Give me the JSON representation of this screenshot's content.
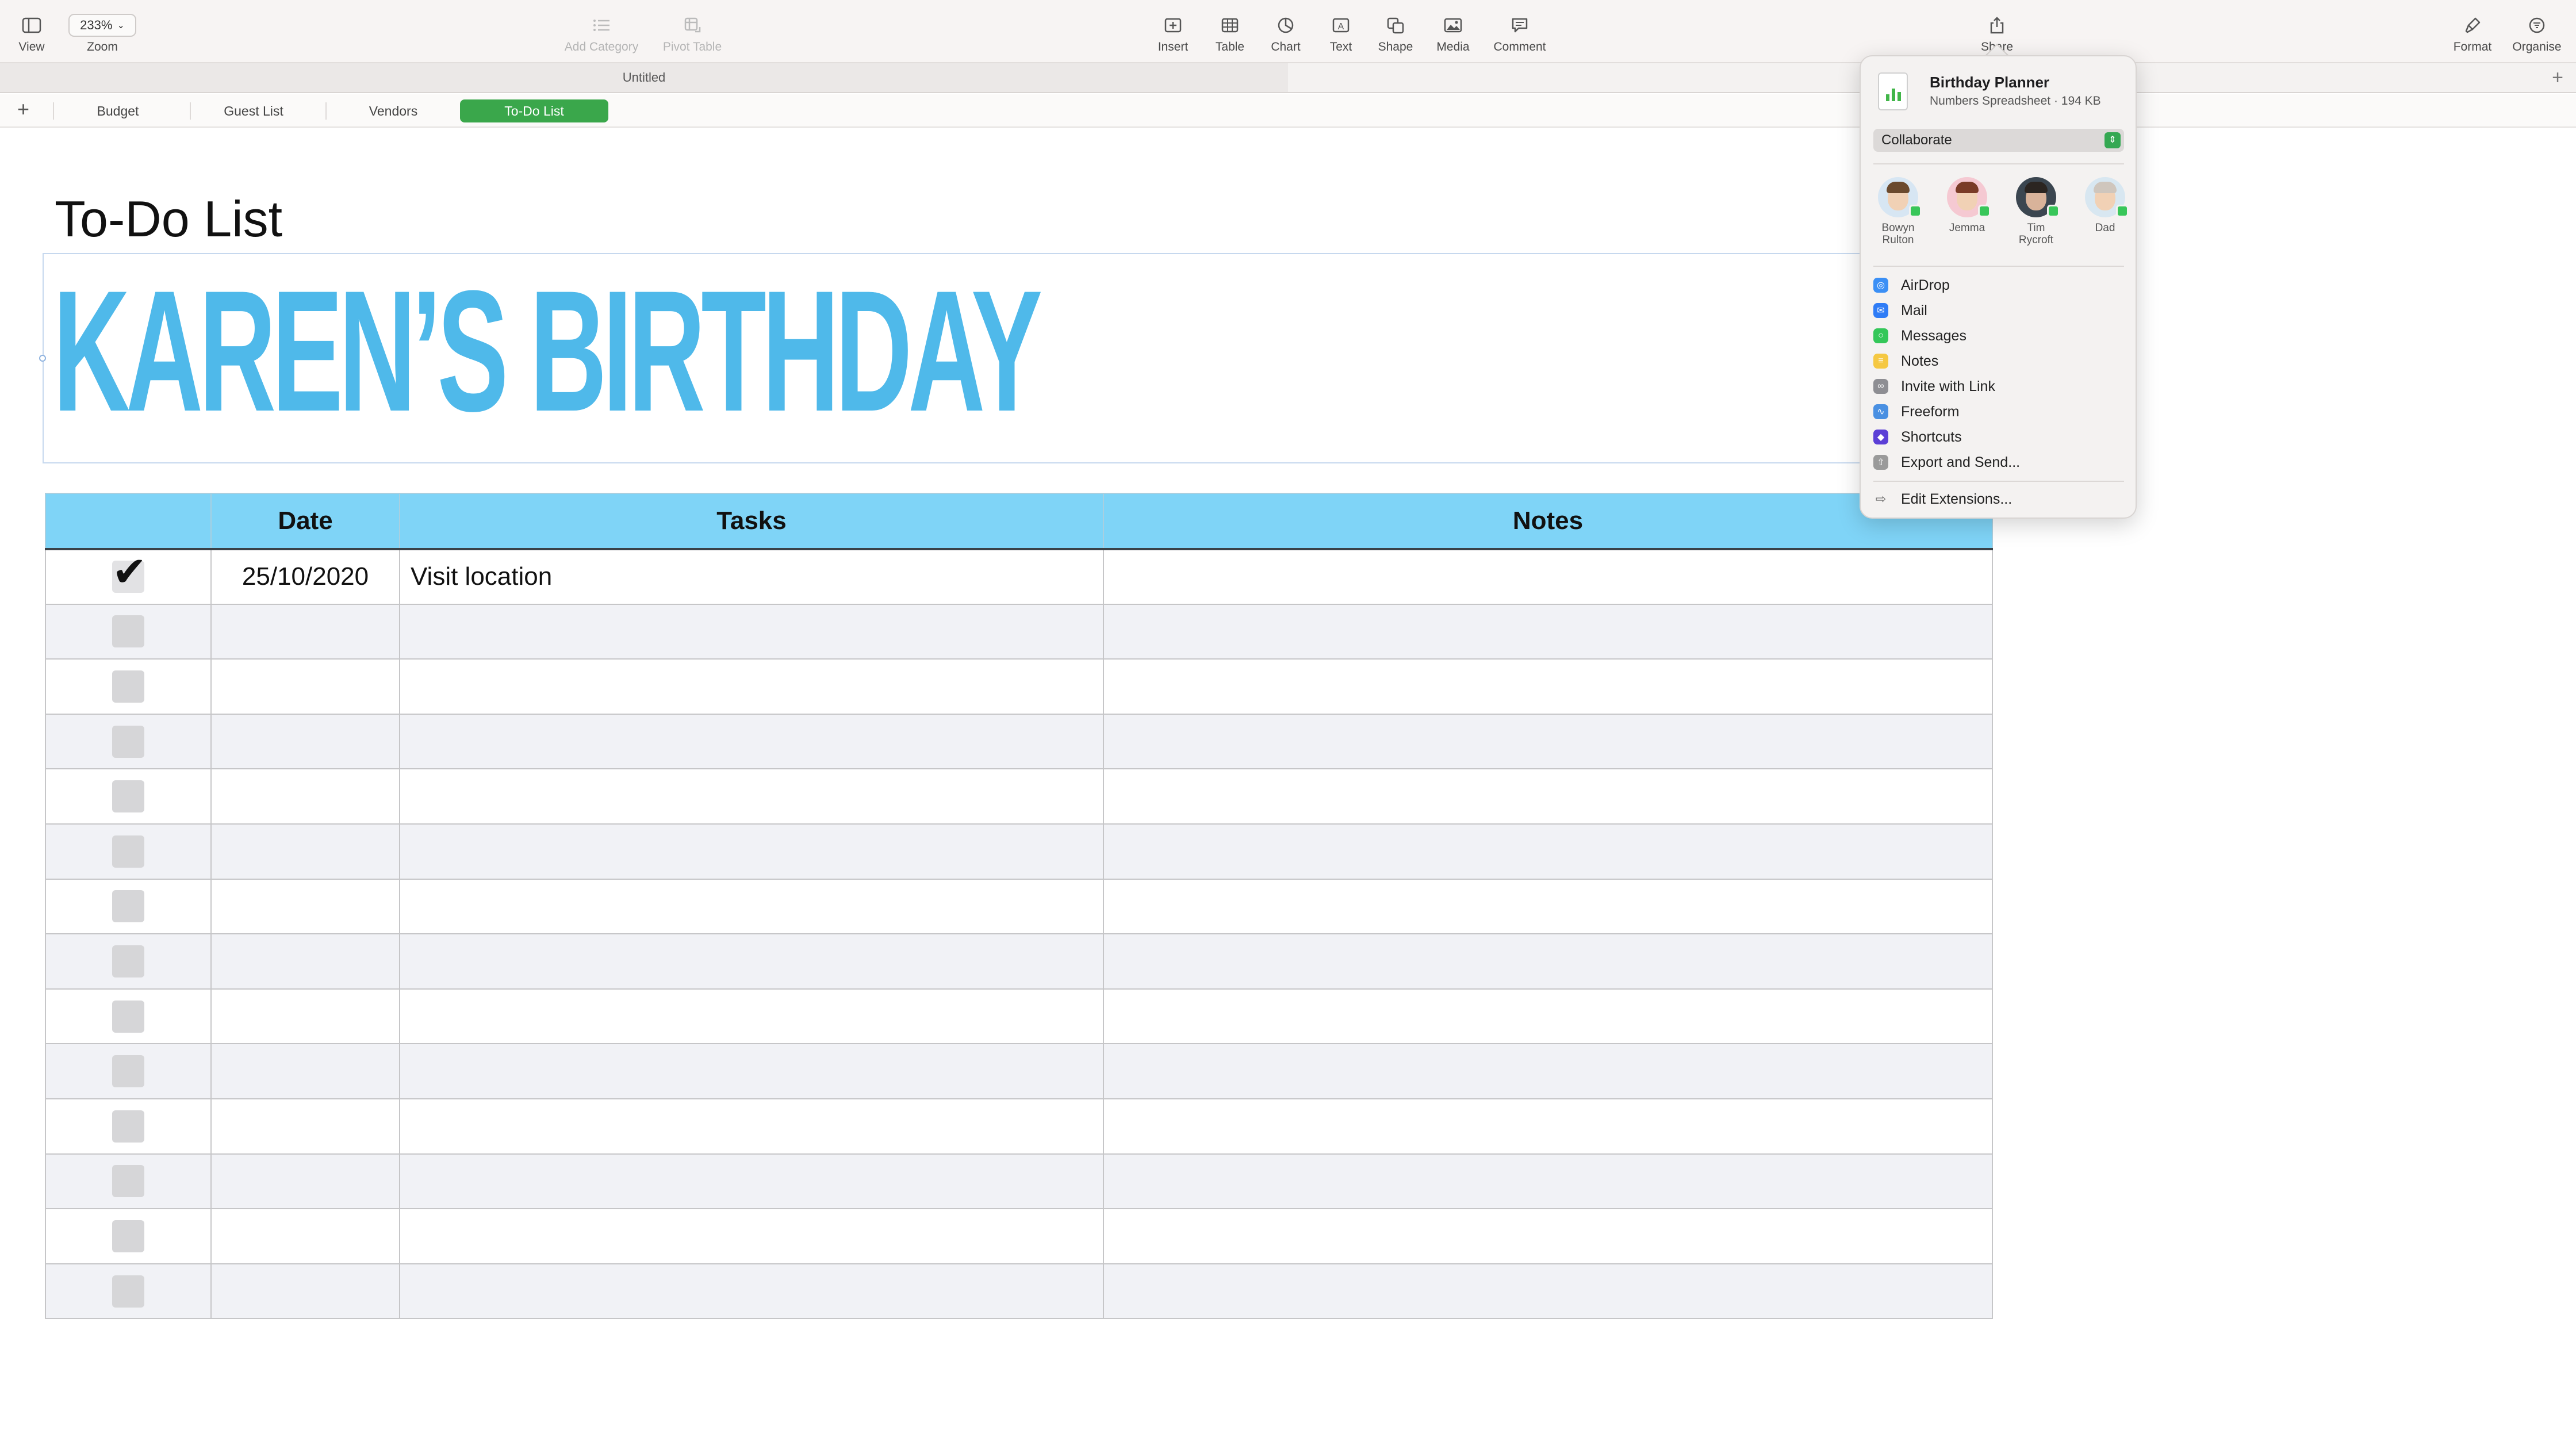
{
  "toolbar": {
    "view": "View",
    "zoom_value": "233%",
    "zoom": "Zoom",
    "add_category": "Add Category",
    "pivot_table": "Pivot Table",
    "insert": "Insert",
    "table": "Table",
    "chart": "Chart",
    "text": "Text",
    "shape": "Shape",
    "media": "Media",
    "comment": "Comment",
    "share": "Share",
    "format": "Format",
    "organise": "Organise"
  },
  "window": {
    "title": "Untitled"
  },
  "sheets": {
    "tabs": [
      "Budget",
      "Guest List",
      "Vendors",
      "To-Do List"
    ],
    "active": "To-Do List"
  },
  "document": {
    "title": "To-Do List",
    "banner": "KAREN’S BIRTHDAY"
  },
  "table": {
    "headers": [
      "",
      "Date",
      "Tasks",
      "Notes"
    ],
    "rows": [
      {
        "checked": true,
        "date": "25/10/2020",
        "task": "Visit location",
        "notes": ""
      }
    ],
    "empty_rows": 13,
    "header_color": "#7fd4f7"
  },
  "share_popover": {
    "file_name": "Birthday Planner",
    "file_meta": "Numbers Spreadsheet · 194 KB",
    "mode": "Collaborate",
    "people": [
      {
        "name": "Bowyn Rulton",
        "line1": "Bowyn",
        "line2": "Rulton"
      },
      {
        "name": "Jemma",
        "line1": "Jemma",
        "line2": ""
      },
      {
        "name": "Tim Rycroft",
        "line1": "Tim",
        "line2": "Rycroft"
      },
      {
        "name": "Dad",
        "line1": "Dad",
        "line2": ""
      }
    ],
    "options": [
      {
        "label": "AirDrop",
        "icon": "airdrop-icon",
        "color": "#3b8ff5"
      },
      {
        "label": "Mail",
        "icon": "mail-icon",
        "color": "#2f7cf6"
      },
      {
        "label": "Messages",
        "icon": "messages-icon",
        "color": "#34c759"
      },
      {
        "label": "Notes",
        "icon": "notes-icon",
        "color": "#f5c842"
      },
      {
        "label": "Invite with Link",
        "icon": "link-icon",
        "color": "#8e8e93"
      },
      {
        "label": "Freeform",
        "icon": "freeform-icon",
        "color": "#4a90e2"
      },
      {
        "label": "Shortcuts",
        "icon": "shortcuts-icon",
        "color": "#5b3fd6"
      },
      {
        "label": "Export and Send...",
        "icon": "export-icon",
        "color": "#9a9a9a"
      }
    ],
    "edit_extensions": "Edit Extensions..."
  }
}
